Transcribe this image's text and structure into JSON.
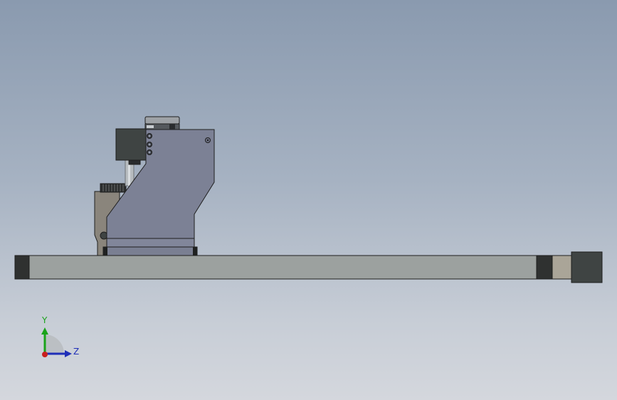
{
  "viewport": {
    "background_top": "#8a9aaf",
    "background_bottom": "#d4d7dd"
  },
  "model": {
    "rail_color": "#9ca19f",
    "end_cap_color": "#2f3130",
    "carriage_color": "#7c8195",
    "motor_color": "#3f4443",
    "bracket_color": "#8a857c",
    "end_block_color": "#aaa598"
  },
  "triad": {
    "y_label": "Y",
    "z_label": "Z",
    "y_color": "#1aa31a",
    "z_color": "#1f2fb8",
    "x_color": "#c81f1f"
  }
}
